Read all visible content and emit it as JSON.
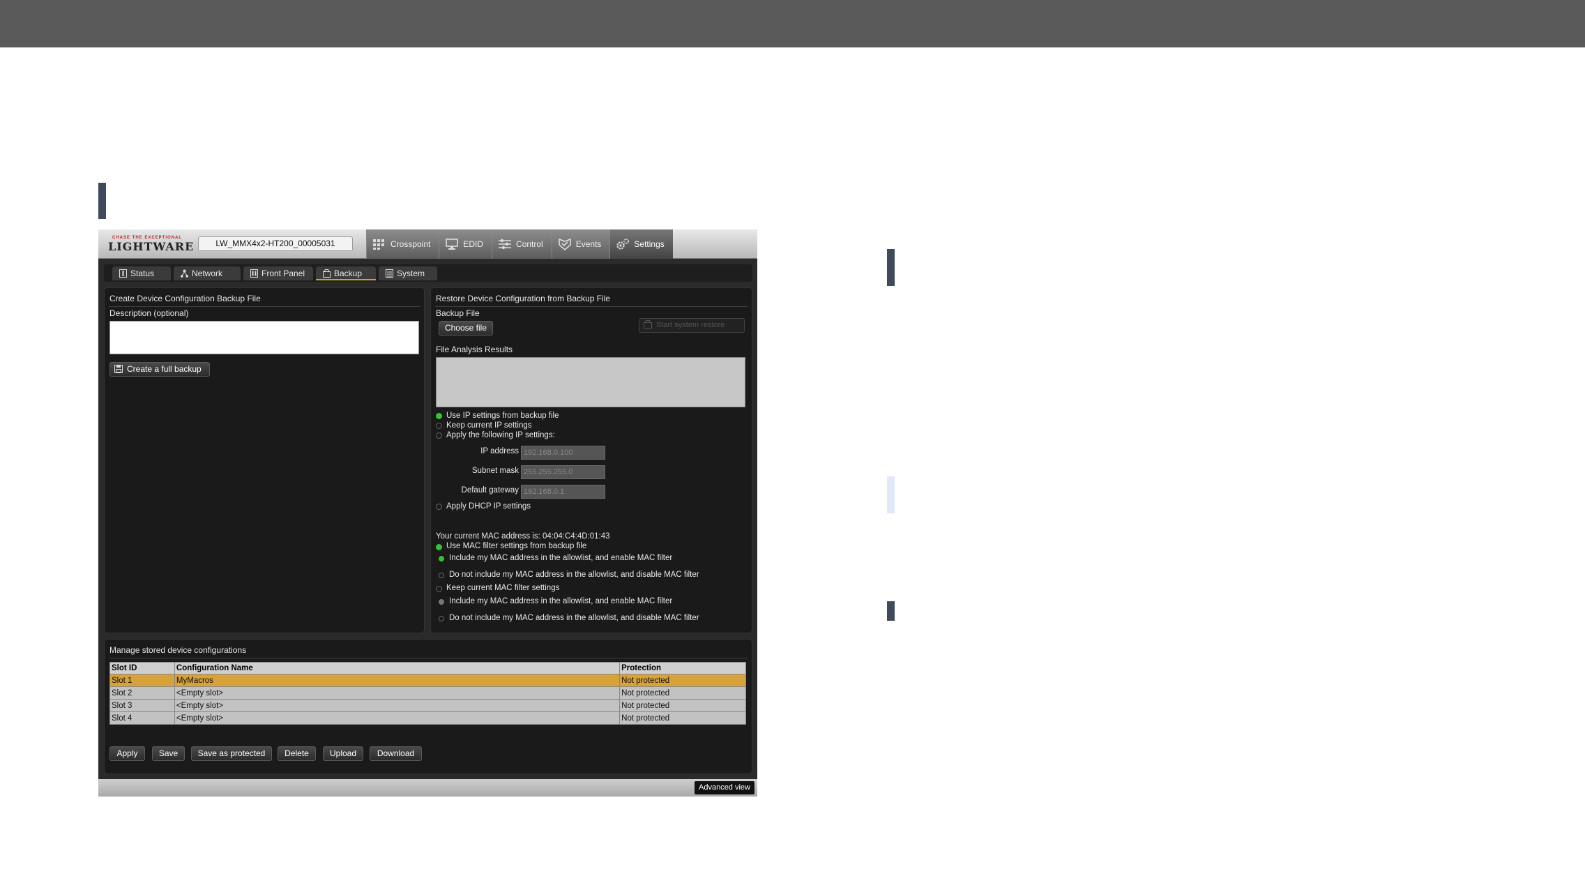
{
  "device": {
    "logo_tag": "CHASE THE EXCEPTIONAL",
    "logo_text": "LIGHTWARE",
    "name": "LW_MMX4x2-HT200_00005031"
  },
  "nav_tabs": [
    {
      "label": "Crosspoint",
      "icon": "grid-icon"
    },
    {
      "label": "EDID",
      "icon": "monitor-icon"
    },
    {
      "label": "Control",
      "icon": "sliders-icon"
    },
    {
      "label": "Events",
      "icon": "shield-icon"
    },
    {
      "label": "Settings",
      "icon": "gear-icon",
      "active": true
    }
  ],
  "sub_tabs": [
    {
      "label": "Status"
    },
    {
      "label": "Network"
    },
    {
      "label": "Front Panel"
    },
    {
      "label": "Backup",
      "active": true
    },
    {
      "label": "System"
    }
  ],
  "create_panel": {
    "title": "Create Device Configuration Backup File",
    "description_label": "Description (optional)",
    "description_value": "",
    "create_button": "Create a full backup"
  },
  "restore_panel": {
    "title": "Restore Device Configuration from Backup File",
    "backup_file_label": "Backup File",
    "choose_file": "Choose file",
    "start_button": "Start system restore",
    "analysis_label": "File Analysis Results",
    "ip_options": [
      "Use IP settings from backup file",
      "Keep current IP settings",
      "Apply the following IP settings:"
    ],
    "ip_address_label": "IP address",
    "ip_address_value": "192.168.0.100",
    "subnet_label": "Subnet mask",
    "subnet_value": "255.255.255.0",
    "gateway_label": "Default gateway",
    "gateway_value": "192.168.0.1",
    "dhcp_option": "Apply DHCP IP settings",
    "mac_text": "Your current MAC address is: 04:04:C4:4D:01:43",
    "mac_use_option": "Use MAC filter settings from backup file",
    "mac_include_option": "Include my MAC address in the allowlist, and enable MAC filter",
    "mac_exclude_option": "Do not include my MAC address in the allowlist, and disable MAC filter",
    "mac_keep_option": "Keep current MAC filter settings",
    "mac_include_option_2": "Include my MAC address in the allowlist, and enable MAC filter",
    "mac_exclude_option_2": "Do not include my MAC address in the allowlist, and disable MAC filter"
  },
  "manage_panel": {
    "title": "Manage stored device configurations",
    "columns": [
      "Slot ID",
      "Configuration Name",
      "Protection"
    ],
    "rows": [
      [
        "Slot 1",
        "MyMacros",
        "Not protected"
      ],
      [
        "Slot 2",
        "<Empty slot>",
        "Not protected"
      ],
      [
        "Slot 3",
        "<Empty slot>",
        "Not protected"
      ],
      [
        "Slot 4",
        "<Empty slot>",
        "Not protected"
      ]
    ],
    "buttons": [
      "Apply",
      "Save",
      "Save as protected",
      "Delete",
      "Upload",
      "Download"
    ]
  },
  "advanced_view": "Advanced view",
  "colors": {
    "top_band": "#5a5a5a",
    "accent": "#3f4a5a",
    "selected_row": "#d7a23a",
    "active_tab_underline": "#d79f1e",
    "radio_on": "#35c235"
  }
}
